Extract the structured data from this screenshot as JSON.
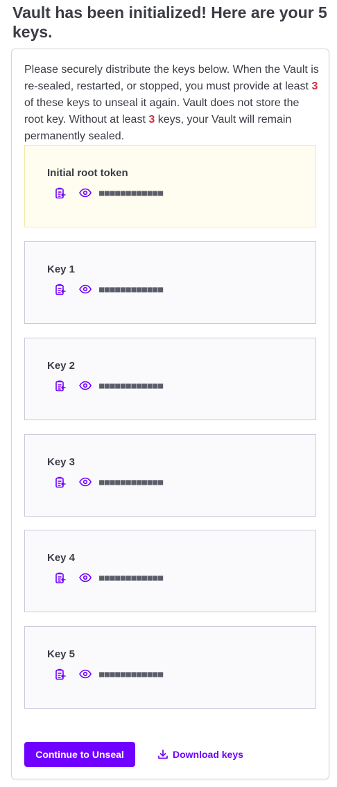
{
  "title": "Vault has been initialized! Here are your 5 keys.",
  "description": {
    "part1": "Please securely distribute the keys below. When the Vault is re-sealed, restarted, or stopped, you must provide at least ",
    "threshold": "3",
    "part2": " of these keys to unseal it again. Vault does not store the root key. Without at least ",
    "threshold_again": "3",
    "part3": " keys, your Vault will remain permanently sealed."
  },
  "root_token": {
    "label": "Initial root token",
    "masked_value": "■■■■■■■■■■■■"
  },
  "keys": [
    {
      "label": "Key 1",
      "masked_value": "■■■■■■■■■■■■"
    },
    {
      "label": "Key 2",
      "masked_value": "■■■■■■■■■■■■"
    },
    {
      "label": "Key 3",
      "masked_value": "■■■■■■■■■■■■"
    },
    {
      "label": "Key 4",
      "masked_value": "■■■■■■■■■■■■"
    },
    {
      "label": "Key 5",
      "masked_value": "■■■■■■■■■■■■"
    }
  ],
  "actions": {
    "continue_label": "Continue to Unseal",
    "download_label": "Download keys"
  },
  "icons": {
    "copy": "clipboard-copy-icon",
    "reveal": "eye-icon",
    "download": "download-icon"
  },
  "colors": {
    "accent": "#7000ff",
    "threshold": "#c73445",
    "root_token_bg": "#fffdf0",
    "key_bg": "#fafafc"
  }
}
